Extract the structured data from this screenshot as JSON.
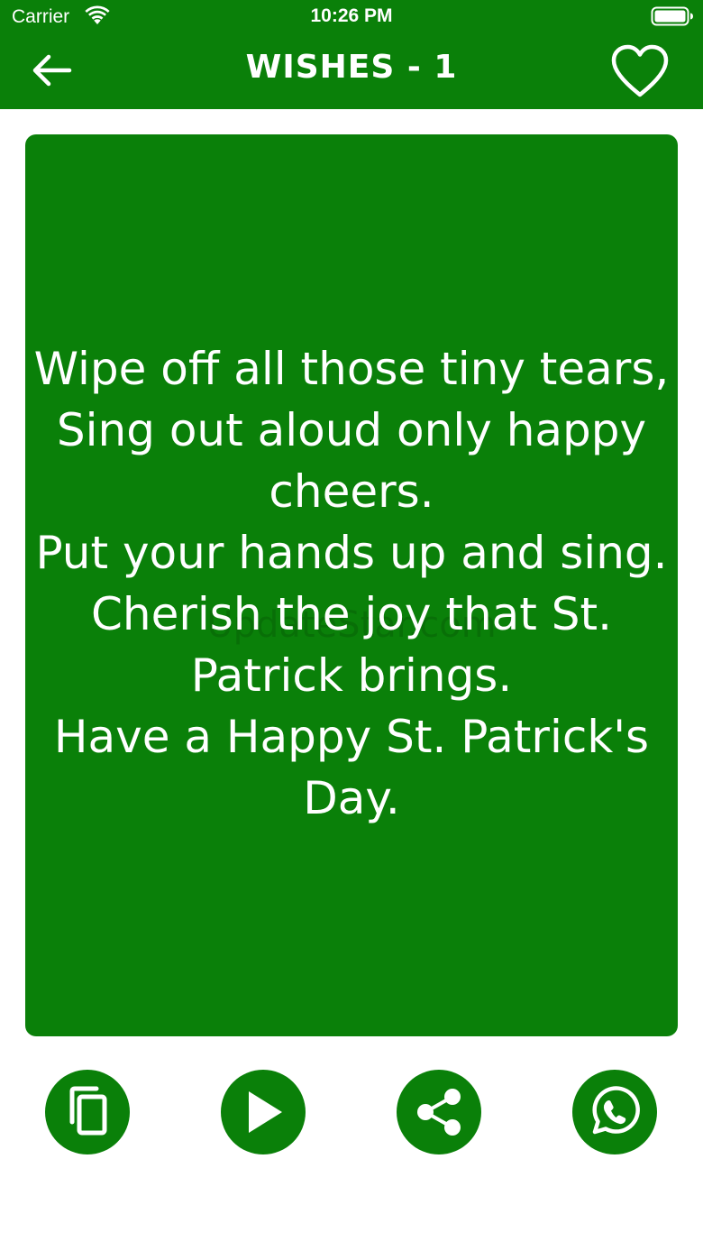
{
  "status_bar": {
    "carrier": "Carrier",
    "time": "10:26 PM"
  },
  "navbar": {
    "title": "WISHES - 1",
    "back_icon": "arrow-left-icon",
    "favorite_icon": "heart-outline-icon"
  },
  "quote": {
    "text": "Wipe off all those tiny tears,\nSing out aloud only happy cheers.\nPut your hands up and sing.\nCherish the joy that St. Patrick brings.\nHave a Happy St. Patrick's Day.",
    "watermark": "UpdateStar.com"
  },
  "actions": [
    {
      "name": "copy",
      "icon": "copy-icon"
    },
    {
      "name": "play",
      "icon": "play-icon"
    },
    {
      "name": "share",
      "icon": "share-icon"
    },
    {
      "name": "whatsapp",
      "icon": "whatsapp-icon"
    }
  ],
  "colors": {
    "brand_green": "#0a8009",
    "text_on_brand": "#ffffff",
    "background": "#ffffff"
  }
}
